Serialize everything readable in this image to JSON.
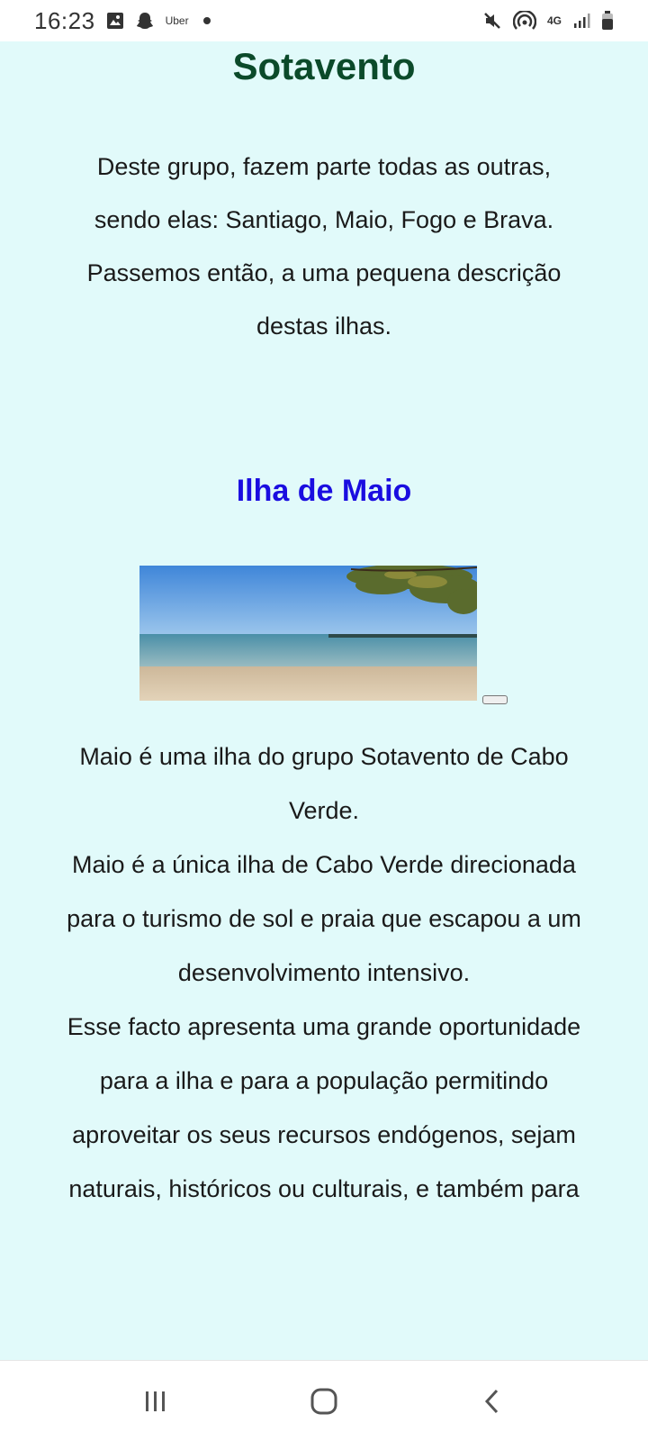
{
  "status_bar": {
    "time": "16:23",
    "left_icons": [
      "gallery-icon",
      "snapchat-icon",
      "uber-icon",
      "notification-dot-icon"
    ],
    "uber_label": "Uber",
    "right_icons": [
      "mute-icon",
      "hotspot-icon",
      "network-4g-icon",
      "signal-icon",
      "battery-icon"
    ],
    "network_label": "4G"
  },
  "page": {
    "title": "Sotavento",
    "intro": "Deste grupo, fazem parte todas as outras, sendo elas: Santiago, Maio, Fogo e Brava. Passemos então, a uma pequena descrição destas ilhas.",
    "section_title": "Ilha de Maio",
    "image": {
      "subject": "beach-photo",
      "colors": {
        "sky": "#6fa8dc",
        "sea": "#8fb6c0",
        "sand": "#d9c7a8",
        "tree": "#5a6b2d"
      }
    },
    "paragraphs": [
      "Maio é uma ilha do grupo Sotavento de Cabo Verde.",
      "Maio é a única ilha de Cabo Verde direcionada para o turismo de sol e praia que escapou a um desenvolvimento intensivo.",
      "Esse facto apresenta uma grande oportunidade para a ilha e para a população permitindo aproveitar os seus recursos endógenos, sejam naturais, históricos ou culturais, e também para"
    ]
  },
  "nav_bar": {
    "buttons": [
      "recent-apps-icon",
      "home-icon",
      "back-icon"
    ]
  },
  "colors": {
    "background": "#e1fafa",
    "title": "#0b4a2a",
    "section_title": "#1a0de0",
    "text": "#1a1a1a"
  }
}
